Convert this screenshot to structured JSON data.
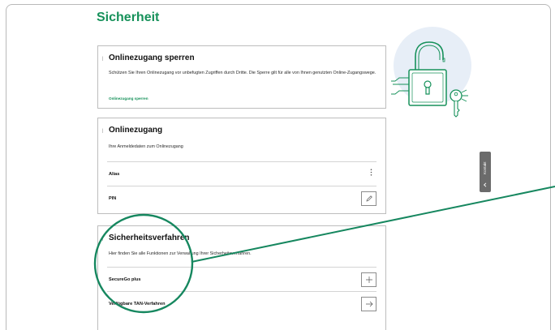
{
  "page": {
    "title": "Sicherheit"
  },
  "cards": {
    "lock": {
      "title": "Onlinezugang sperren",
      "description": "Schützen Sie Ihren Onlinezugang vor unbefugten Zugriffen durch Dritte. Die Sperre gilt für alle von Ihnen genutzten Online-Zugangswege.",
      "link_label": "Onlinezugang sperren"
    },
    "access": {
      "title": "Onlinezugang",
      "description": "Ihre Anmeldedaten zum Onlinezugang",
      "rows": [
        {
          "label": "Alias",
          "control": "more-icon"
        },
        {
          "label": "PIN",
          "control": "pencil-icon"
        }
      ]
    },
    "methods": {
      "title": "Sicherheitsverfahren",
      "description": "Hier finden Sie alle Funktionen zur Verwaltung Ihrer Sicherheitsverfahren.",
      "rows": [
        {
          "label": "SecureGo plus",
          "control": "plus-icon"
        },
        {
          "label": "Verfügbare TAN-Verfahren",
          "control": "arrow-right-icon"
        }
      ]
    }
  },
  "sidetab": {
    "label": "Kontakt"
  },
  "colors": {
    "brand_green": "#16915a",
    "illustration_bg": "#e7eef7",
    "tab_grey": "#6b6b6b"
  },
  "icons": {
    "illustration": "padlock-key-icon",
    "menu": "more-icon"
  }
}
